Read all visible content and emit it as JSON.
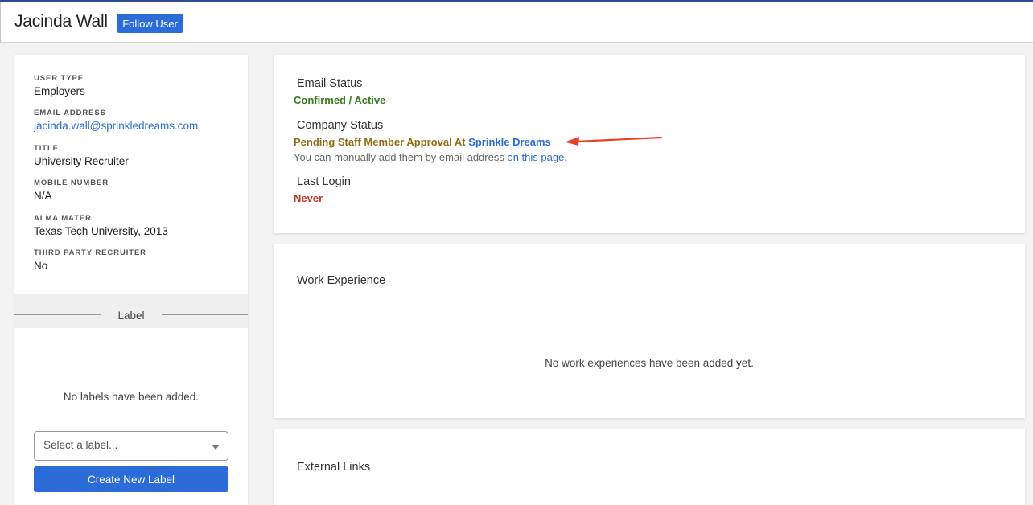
{
  "header": {
    "user_name": "Jacinda Wall",
    "follow_label": "Follow User"
  },
  "profile": {
    "fields": [
      {
        "label": "USER TYPE",
        "value": "Employers"
      },
      {
        "label": "EMAIL ADDRESS",
        "value": "jacinda.wall@sprinkledreams.com"
      },
      {
        "label": "TITLE",
        "value": "University Recruiter"
      },
      {
        "label": "MOBILE NUMBER",
        "value": "N/A"
      },
      {
        "label": "ALMA MATER",
        "value": "Texas Tech University, 2013"
      },
      {
        "label": "THIRD PARTY RECRUITER",
        "value": "No"
      }
    ]
  },
  "labels": {
    "heading": "Label",
    "empty_text": "No labels have been added.",
    "select_placeholder": "Select a label...",
    "create_button": "Create New Label"
  },
  "status": {
    "email_title": "Email Status",
    "email_value": "Confirmed / Active",
    "company_title": "Company Status",
    "company_value_prefix": "Pending Staff Member Approval At",
    "company_name": "Sprinkle Dreams",
    "company_hint_prefix": "You can manually add them by email address",
    "company_hint_link": "on this page.",
    "login_title": "Last Login",
    "login_value": "Never"
  },
  "work": {
    "title": "Work Experience",
    "empty_text": "No work experiences have been added yet."
  },
  "links": {
    "title": "External Links"
  },
  "colors": {
    "accent": "#2c6cd8",
    "confirmed": "#3a7d1c",
    "pending": "#8f6d12",
    "never": "#c0392b",
    "arrow": "#e8412c"
  }
}
